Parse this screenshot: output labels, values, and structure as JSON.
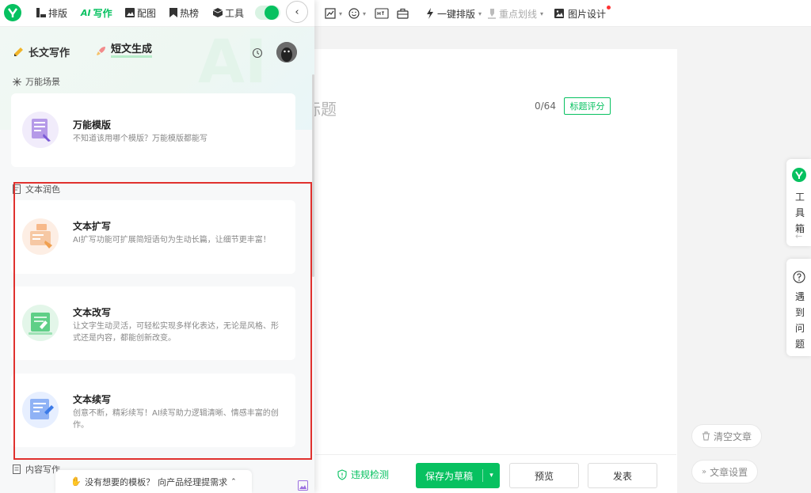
{
  "toolbar": {
    "one_click_format": "一键排版",
    "highlight": "重点划线",
    "image_design": "图片设计"
  },
  "editor": {
    "title_placeholder": "标题",
    "title_counter": "0/64",
    "title_score_button": "标题评分"
  },
  "right_side": {
    "toolbox": [
      "工",
      "具",
      "箱"
    ],
    "help": [
      "遇",
      "到",
      "问",
      "题"
    ],
    "clear_article": "清空文章",
    "article_settings": "文章设置"
  },
  "bottom_bar": {
    "compliance_check": "违规检测",
    "save_draft": "保存为草稿",
    "preview": "预览",
    "publish": "发表"
  },
  "panel": {
    "tabs": [
      {
        "label": "排版",
        "active": false
      },
      {
        "label": "写作",
        "active": true
      },
      {
        "label": "配图",
        "active": false
      },
      {
        "label": "热榜",
        "active": false
      },
      {
        "label": "工具",
        "active": false
      }
    ],
    "mode_tabs": {
      "long": "长文写作",
      "short": "短文生成"
    },
    "sections": {
      "universal": "万能场景",
      "polish": "文本润色",
      "content": "内容写作"
    },
    "cards": [
      {
        "title": "万能模版",
        "desc": "不知道该用哪个模版？万能模版都能写"
      },
      {
        "title": "文本扩写",
        "desc": "AI扩写功能可扩展简短语句为生动长篇，让细节更丰富！"
      },
      {
        "title": "文本改写",
        "desc": "让文字生动灵活，可轻松实现多样化表达，无论是风格、形式还是内容，都能创新改变。"
      },
      {
        "title": "文本续写",
        "desc": "创意不断，精彩续写！AI续写助力逻辑清晰、情感丰富的创作。"
      }
    ],
    "footer_prompt": "没有想要的模板？",
    "footer_link": "向产品经理提需求"
  },
  "colors": {
    "brand_green": "#07c160",
    "highlight_red": "#e0312e"
  }
}
